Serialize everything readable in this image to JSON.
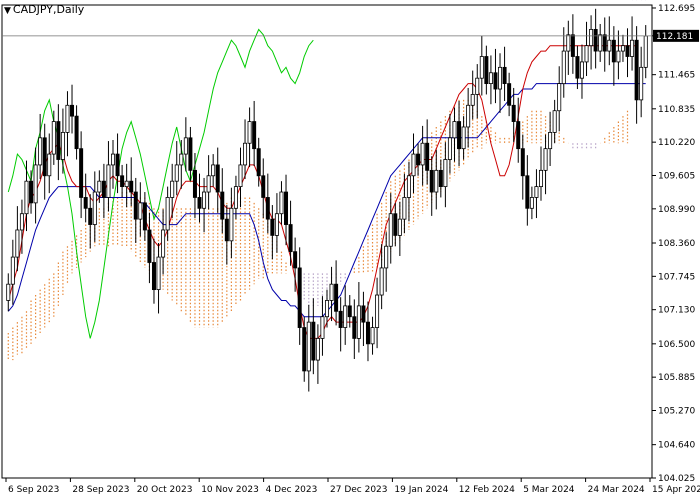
{
  "symbol_title": "CADJPY,Daily",
  "current_price_label": "112.181",
  "colors": {
    "candle": "#000000",
    "tenkan": "#cc0000",
    "kijun": "#0000aa",
    "chikou": "#00cc00",
    "cloud_up": "#e8893a",
    "cloud_down": "#b8a4c8",
    "price_line": "#707070"
  },
  "chart_data": {
    "type": "candlestick-ichimoku",
    "ylim": [
      104.025,
      112.75
    ],
    "y_ticks": [
      "112.695",
      "112.181",
      "111.465",
      "110.835",
      "110.220",
      "109.605",
      "108.990",
      "108.360",
      "107.745",
      "107.130",
      "106.500",
      "105.885",
      "105.270",
      "104.640",
      "104.025"
    ],
    "x_ticks": [
      "6 Sep 2023",
      "28 Sep 2023",
      "20 Oct 2023",
      "10 Nov 2023",
      "4 Dec 2023",
      "27 Dec 2023",
      "19 Jan 2024",
      "12 Feb 2024",
      "5 Mar 2024",
      "24 Mar 2024",
      "15 Apr 2024"
    ],
    "close": [
      107.6,
      108.1,
      108.6,
      108.9,
      109.5,
      109.1,
      109.8,
      110.3,
      109.6,
      110.0,
      110.6,
      109.9,
      110.4,
      110.9,
      110.7,
      110.1,
      109.2,
      109.0,
      108.7,
      109.3,
      109.5,
      109.2,
      109.8,
      110.0,
      109.6,
      109.4,
      109.5,
      109.3,
      108.8,
      109.1,
      108.6,
      108.0,
      107.5,
      108.1,
      108.6,
      109.2,
      109.5,
      109.8,
      110.0,
      110.3,
      109.7,
      109.2,
      109.0,
      109.3,
      109.6,
      109.8,
      109.3,
      108.8,
      108.4,
      109.0,
      109.4,
      109.8,
      110.2,
      110.6,
      110.1,
      109.6,
      109.2,
      108.8,
      108.5,
      108.9,
      109.3,
      108.7,
      108.2,
      107.9,
      106.8,
      106.0,
      106.9,
      106.2,
      106.6,
      107.0,
      107.3,
      107.6,
      107.1,
      106.8,
      107.2,
      107.0,
      106.6,
      107.2,
      106.9,
      106.5,
      106.8,
      107.4,
      107.9,
      108.3,
      108.9,
      108.5,
      108.8,
      109.2,
      109.6,
      110.0,
      109.8,
      110.2,
      109.7,
      109.3,
      109.7,
      109.4,
      109.9,
      110.3,
      110.6,
      110.1,
      110.5,
      110.9,
      111.1,
      111.4,
      111.8,
      111.3,
      111.5,
      111.2,
      111.6,
      111.3,
      110.9,
      110.6,
      110.1,
      109.6,
      109.0,
      109.2,
      109.4,
      109.7,
      110.1,
      110.4,
      110.8,
      111.3,
      111.9,
      112.2,
      111.8,
      111.4,
      111.7,
      112.0,
      112.3,
      111.9,
      112.2,
      111.9,
      112.1,
      111.7,
      111.9,
      112.0,
      111.8,
      112.1,
      111.0,
      111.6,
      112.18
    ],
    "tenkan_sen": [
      107.3,
      107.6,
      107.9,
      108.4,
      108.9,
      109.2,
      109.3,
      109.5,
      109.8,
      110.0,
      110.1,
      110.2,
      110.0,
      109.7,
      109.5,
      109.4,
      109.4,
      109.4,
      109.2,
      109.1,
      109.2,
      109.3,
      109.5,
      109.6,
      109.5,
      109.5,
      109.4,
      109.3,
      109.2,
      109.1,
      108.8,
      108.6,
      108.4,
      108.3,
      108.4,
      108.6,
      108.9,
      109.2,
      109.4,
      109.5,
      109.5,
      109.5,
      109.4,
      109.4,
      109.4,
      109.4,
      109.3,
      109.1,
      109.0,
      109.0,
      109.2,
      109.4,
      109.6,
      109.8,
      109.8,
      109.6,
      109.3,
      109.0,
      108.8,
      108.8,
      108.7,
      108.4,
      108.1,
      107.7,
      107.2,
      106.8,
      106.6,
      106.6,
      106.6,
      106.7,
      106.9,
      107.0,
      106.9,
      106.9,
      106.9,
      106.9,
      106.9,
      106.9,
      107.0,
      107.2,
      107.5,
      107.9,
      108.3,
      108.7,
      108.9,
      109.1,
      109.3,
      109.5,
      109.6,
      109.7,
      109.8,
      109.9,
      109.9,
      109.9,
      110.1,
      110.3,
      110.5,
      110.7,
      110.9,
      111.1,
      111.2,
      111.3,
      111.3,
      111.2,
      111.0,
      110.6,
      110.2,
      109.9,
      109.6,
      109.6,
      109.8,
      110.2,
      110.7,
      111.2,
      111.5,
      111.7,
      111.8,
      111.9,
      111.9,
      112.0,
      112.0,
      112.0,
      112.0,
      112.0,
      112.0,
      112.0,
      112.0,
      112.0,
      112.0,
      112.0,
      112.0,
      112.0,
      112.0,
      112.0,
      112.0,
      112.0,
      112.0,
      112.0,
      112.0
    ],
    "kijun_sen": [
      107.1,
      107.2,
      107.4,
      107.7,
      108.0,
      108.3,
      108.6,
      108.8,
      109.0,
      109.2,
      109.3,
      109.4,
      109.4,
      109.4,
      109.4,
      109.4,
      109.4,
      109.4,
      109.4,
      109.3,
      109.2,
      109.2,
      109.2,
      109.2,
      109.2,
      109.2,
      109.2,
      109.2,
      109.2,
      109.1,
      109.1,
      109.0,
      108.9,
      108.8,
      108.7,
      108.7,
      108.7,
      108.7,
      108.8,
      108.9,
      108.9,
      108.9,
      108.9,
      108.9,
      108.9,
      108.9,
      108.9,
      108.9,
      108.9,
      108.9,
      108.9,
      108.9,
      108.9,
      108.9,
      108.7,
      108.4,
      108.0,
      107.7,
      107.5,
      107.4,
      107.3,
      107.3,
      107.2,
      107.2,
      107.1,
      107.0,
      107.0,
      107.0,
      107.0,
      107.0,
      107.1,
      107.2,
      107.3,
      107.4,
      107.6,
      107.8,
      108.0,
      108.2,
      108.4,
      108.6,
      108.8,
      109.0,
      109.2,
      109.4,
      109.6,
      109.7,
      109.8,
      109.9,
      110.0,
      110.1,
      110.2,
      110.3,
      110.3,
      110.3,
      110.3,
      110.3,
      110.3,
      110.3,
      110.3,
      110.3,
      110.3,
      110.3,
      110.3,
      110.3,
      110.4,
      110.5,
      110.6,
      110.7,
      110.8,
      110.9,
      111.0,
      111.1,
      111.1,
      111.2,
      111.2,
      111.2,
      111.3,
      111.3,
      111.3,
      111.3,
      111.3,
      111.3,
      111.3,
      111.3,
      111.3,
      111.3,
      111.3,
      111.3,
      111.3,
      111.3,
      111.3,
      111.3,
      111.3,
      111.3,
      111.3,
      111.3,
      111.3,
      111.3,
      111.3,
      111.3,
      111.3
    ],
    "chikou_span": [
      109.3,
      109.6,
      110.0,
      109.9,
      109.7,
      109.5,
      110.1,
      110.4,
      110.8,
      111.0,
      110.6,
      110.3,
      109.8,
      109.4,
      108.9,
      108.2,
      107.6,
      107.0,
      106.6,
      106.9,
      107.3,
      107.9,
      108.5,
      109.1,
      109.6,
      110.1,
      110.4,
      110.6,
      110.3,
      110.0,
      109.6,
      109.2,
      108.8,
      109.0,
      109.4,
      109.8,
      110.2,
      110.5,
      110.1,
      109.7,
      109.5,
      109.8,
      110.1,
      110.4,
      110.8,
      111.2,
      111.5,
      111.7,
      111.9,
      112.1,
      112.0,
      111.8,
      111.6,
      111.9,
      112.1,
      112.3,
      112.2,
      112.0,
      111.9,
      111.7,
      111.5,
      111.6,
      111.4,
      111.3,
      111.5,
      111.8,
      112.0,
      112.1
    ],
    "senkou_a": [
      106.7,
      106.8,
      106.9,
      107.0,
      107.1,
      107.3,
      107.4,
      107.5,
      107.6,
      107.7,
      107.8,
      108.0,
      108.2,
      108.3,
      108.4,
      108.5,
      108.6,
      108.7,
      108.8,
      108.9,
      109.0,
      109.0,
      109.1,
      109.2,
      109.2,
      109.3,
      109.3,
      109.3,
      109.3,
      109.2,
      109.2,
      109.1,
      109.0,
      109.0,
      109.0,
      109.0,
      109.0,
      109.0,
      109.0,
      109.0,
      109.0,
      109.0,
      109.0,
      109.0,
      109.0,
      109.0,
      109.0,
      109.0,
      109.1,
      109.2,
      109.2,
      109.2,
      109.2,
      109.2,
      109.1,
      109.0,
      108.9,
      108.8,
      108.6,
      108.4,
      108.2,
      108.0,
      107.8,
      107.6,
      107.4,
      107.3,
      107.2,
      107.2,
      107.2,
      107.2,
      107.3,
      107.4,
      107.5,
      107.6,
      107.7,
      107.8,
      107.9,
      108.1,
      108.3,
      108.5,
      108.7,
      108.9,
      109.1,
      109.3,
      109.5,
      109.6,
      109.7,
      109.8,
      109.9,
      110.0,
      110.1,
      110.2,
      110.3,
      110.4,
      110.5,
      110.6,
      110.7,
      110.8,
      110.9,
      111.0,
      111.0,
      111.0,
      110.9,
      110.8,
      110.7,
      110.6,
      110.5,
      110.4,
      110.3,
      110.3,
      110.3,
      110.4,
      110.5,
      110.6,
      110.7,
      110.8,
      110.8,
      110.8,
      110.7,
      110.6,
      110.5,
      110.4,
      110.3,
      110.2,
      110.1,
      110.1,
      110.1,
      110.1,
      110.1,
      110.1,
      110.2,
      110.3,
      110.4,
      110.5,
      110.6,
      110.7,
      110.8,
      110.9,
      111.0,
      111.0,
      111.0
    ],
    "senkou_b": [
      106.2,
      106.2,
      106.3,
      106.3,
      106.4,
      106.5,
      106.6,
      106.7,
      106.8,
      106.9,
      107.0,
      107.2,
      107.4,
      107.6,
      107.8,
      107.9,
      108.0,
      108.1,
      108.2,
      108.3,
      108.3,
      108.3,
      108.3,
      108.3,
      108.3,
      108.3,
      108.3,
      108.2,
      108.1,
      108.0,
      107.9,
      107.8,
      107.7,
      107.6,
      107.5,
      107.4,
      107.3,
      107.2,
      107.1,
      107.0,
      106.9,
      106.8,
      106.8,
      106.8,
      106.8,
      106.8,
      106.8,
      106.9,
      107.0,
      107.1,
      107.2,
      107.3,
      107.4,
      107.5,
      107.6,
      107.7,
      107.7,
      107.8,
      107.8,
      107.8,
      107.8,
      107.8,
      107.8,
      107.8,
      107.8,
      107.8,
      107.8,
      107.8,
      107.8,
      107.8,
      107.8,
      107.8,
      107.8,
      107.8,
      107.8,
      107.8,
      107.8,
      107.8,
      107.8,
      107.8,
      107.8,
      107.9,
      108.0,
      108.1,
      108.2,
      108.3,
      108.4,
      108.5,
      108.6,
      108.7,
      108.8,
      108.9,
      109.0,
      109.1,
      109.2,
      109.3,
      109.4,
      109.5,
      109.6,
      109.7,
      109.8,
      109.9,
      110.0,
      110.1,
      110.1,
      110.2,
      110.2,
      110.2,
      110.2,
      110.2,
      110.2,
      110.2,
      110.2,
      110.2,
      110.2,
      110.2,
      110.2,
      110.2,
      110.2,
      110.2,
      110.2,
      110.2,
      110.2,
      110.2,
      110.2,
      110.2,
      110.2,
      110.2,
      110.2,
      110.2,
      110.2,
      110.2,
      110.2,
      110.2,
      110.2,
      110.2,
      110.2
    ]
  }
}
